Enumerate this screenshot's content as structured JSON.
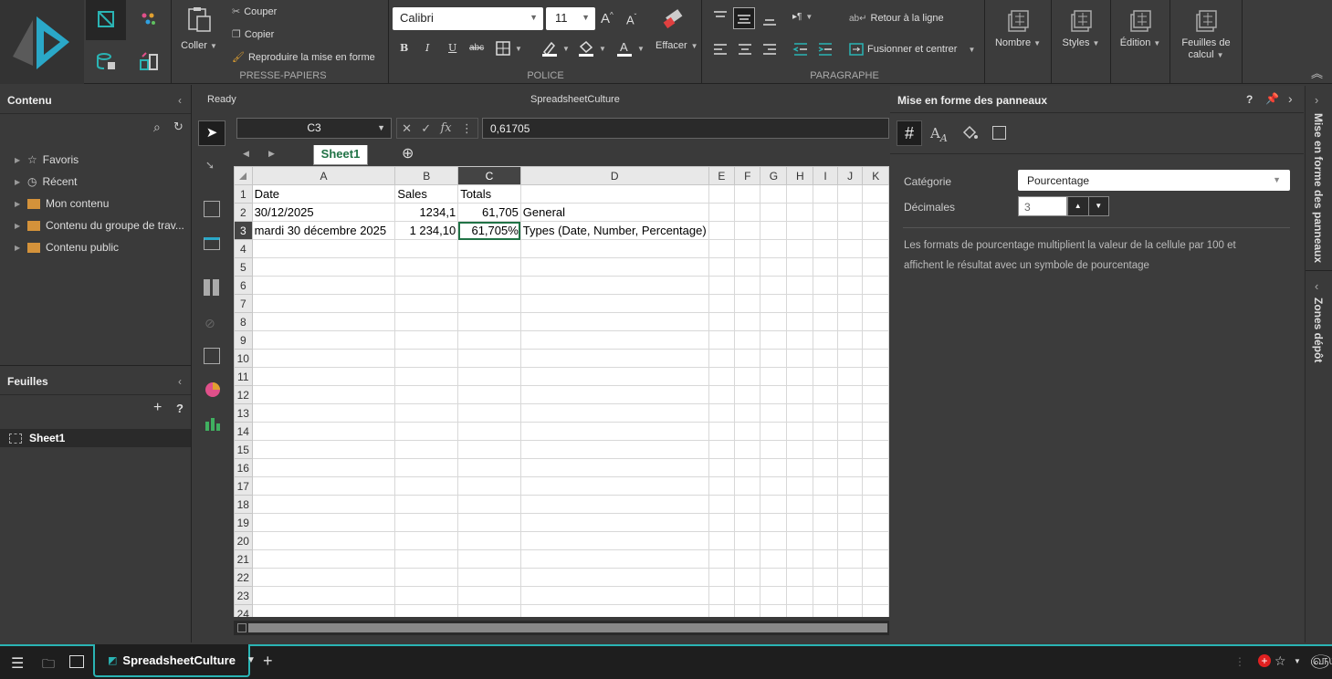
{
  "ribbon": {
    "clipboard": {
      "paste": "Coller",
      "cut": "Couper",
      "copy": "Copier",
      "format_painter": "Reproduire la mise en forme",
      "group": "PRESSE-PAPIERS"
    },
    "font": {
      "name": "Calibri",
      "size": "11",
      "bold": "B",
      "italic": "I",
      "strike": "abc",
      "clear": "Effacer",
      "group": "POLICE"
    },
    "paragraph": {
      "wrap": "Retour à la ligne",
      "merge": "Fusionner et centrer",
      "group": "PARAGRAPHE"
    },
    "number": "Nombre",
    "styles": "Styles",
    "editing": "Édition",
    "sheets_line1": "Feuilles de",
    "sheets_line2": "calcul"
  },
  "left": {
    "content_title": "Contenu",
    "tree": [
      "Favoris",
      "Récent",
      "Mon contenu",
      "Contenu du groupe de trav...",
      "Contenu public"
    ],
    "sheets_title": "Feuilles",
    "sheet_item": "Sheet1"
  },
  "status": {
    "ready": "Ready",
    "doc_title": "SpreadsheetCulture"
  },
  "formula_bar": {
    "name_box": "C3",
    "value": "0,61705"
  },
  "sheet_tab": "Sheet1",
  "grid": {
    "columns": [
      "A",
      "B",
      "C",
      "D",
      "E",
      "F",
      "G",
      "H",
      "I",
      "J",
      "K"
    ],
    "rows": [
      [
        "Date",
        "Sales",
        "Totals",
        "",
        "",
        "",
        "",
        "",
        "",
        "",
        ""
      ],
      [
        "30/12/2025",
        "1234,1",
        "61,705",
        "General",
        "",
        "",
        "",
        "",
        "",
        "",
        ""
      ],
      [
        "mardi 30 décembre 2025",
        "1 234,10",
        "61,705%",
        "Types (Date, Number, Percentage)",
        "",
        "",
        "",
        "",
        "",
        "",
        ""
      ]
    ],
    "row_numbers": [
      "1",
      "2",
      "3",
      "4",
      "5",
      "6",
      "7",
      "8",
      "9",
      "10",
      "11",
      "12",
      "13",
      "14",
      "15",
      "16",
      "17",
      "18",
      "19",
      "20",
      "21",
      "22",
      "23",
      "24"
    ]
  },
  "format_panel": {
    "title": "Mise en forme des panneaux",
    "help": "?",
    "category_label": "Catégorie",
    "category_value": "Pourcentage",
    "decimals_label": "Décimales",
    "decimals_value": "3",
    "description": "Les formats de pourcentage multiplient la valeur de la cellule par 100 et affichent le résultat avec un symbole de pourcentage"
  },
  "side_strip": {
    "format": "Mise en forme des panneaux",
    "drop": "Zones dépôt"
  },
  "taskbar": {
    "tab": "SpreadsheetCulture"
  },
  "colors": {
    "accent": "#2ab4b4",
    "selected_cell": "#217346",
    "tab_text": "#217346"
  }
}
